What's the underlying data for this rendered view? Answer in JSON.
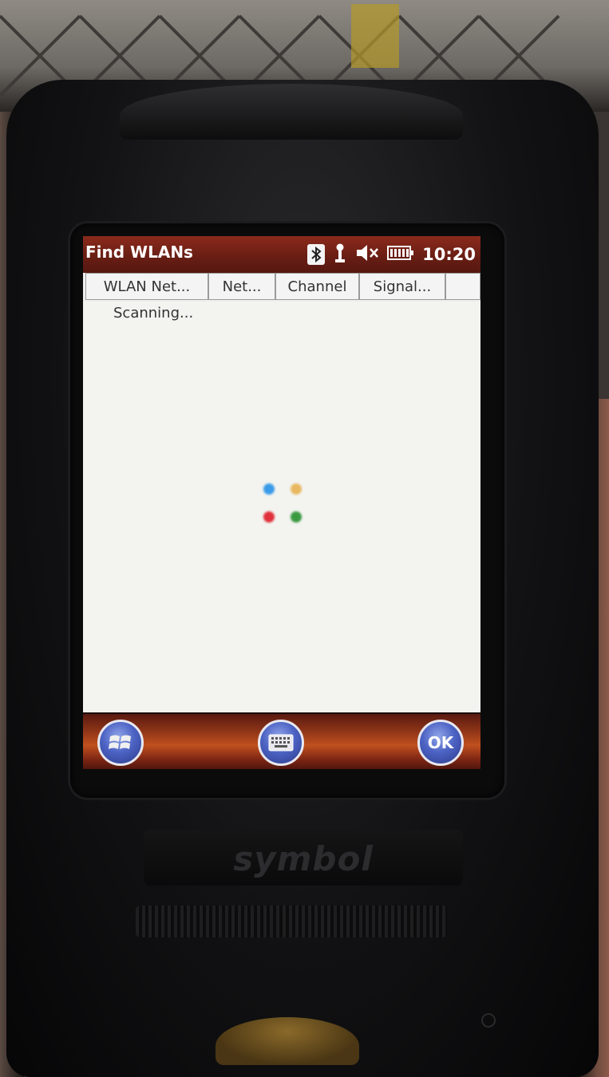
{
  "window": {
    "title": "Find WLANs",
    "time": "10:20"
  },
  "status_icons": [
    "bluetooth-icon",
    "antenna-icon",
    "speaker-muted-icon",
    "battery-icon"
  ],
  "columns": [
    {
      "label": "WLAN Net..."
    },
    {
      "label": "Net..."
    },
    {
      "label": "Channel"
    },
    {
      "label": "Signal..."
    },
    {
      "label": ""
    }
  ],
  "list": {
    "status": "Scanning..."
  },
  "spinner": {
    "colors": [
      "#3a9be8",
      "#e8b860",
      "#e0303a",
      "#3a9a40"
    ]
  },
  "toolbar": {
    "start_icon": "windows-start-icon",
    "keyboard_icon": "keyboard-icon",
    "ok_label": "OK"
  },
  "device": {
    "brand": "symbol"
  }
}
